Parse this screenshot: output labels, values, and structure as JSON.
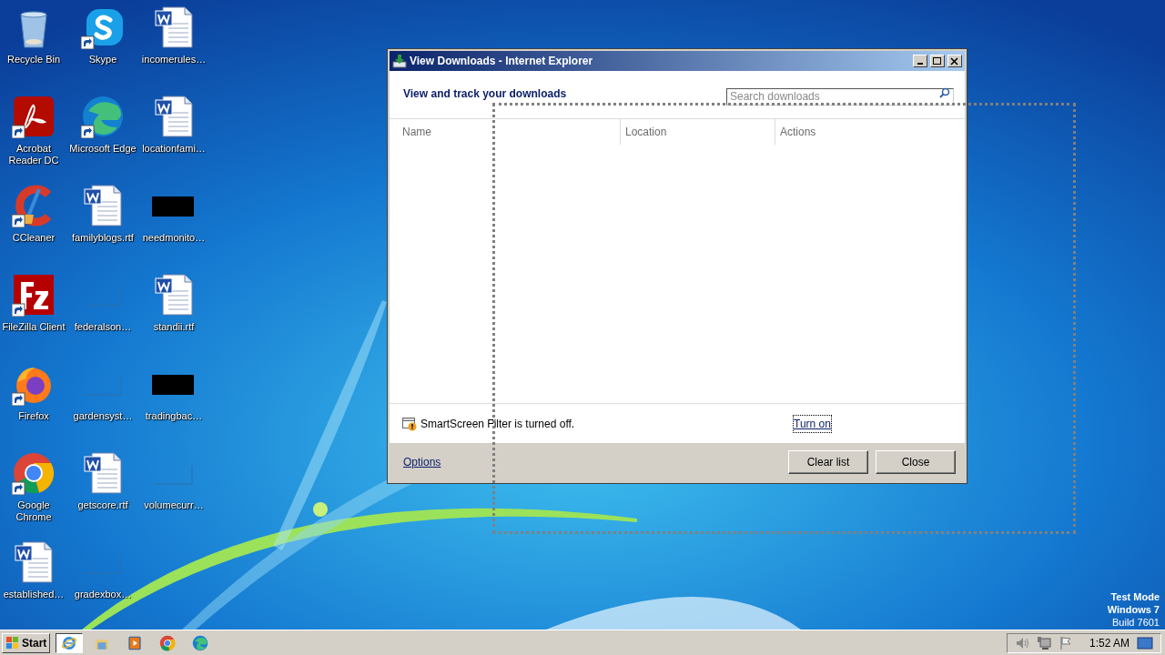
{
  "desktop": {
    "icons": [
      {
        "label": "Recycle Bin",
        "kind": "recycle",
        "shortcut": false
      },
      {
        "label": "Skype",
        "kind": "skype",
        "shortcut": true
      },
      {
        "label": "incomerules…",
        "kind": "word",
        "shortcut": false
      },
      {
        "label": "Acrobat Reader DC",
        "kind": "acrobat",
        "shortcut": true
      },
      {
        "label": "Microsoft Edge",
        "kind": "edge",
        "shortcut": true
      },
      {
        "label": "locationfami…",
        "kind": "word",
        "shortcut": false
      },
      {
        "label": "CCleaner",
        "kind": "ccleaner",
        "shortcut": true
      },
      {
        "label": "familyblogs.rtf",
        "kind": "word",
        "shortcut": false
      },
      {
        "label": "needmonito…",
        "kind": "dark",
        "shortcut": false
      },
      {
        "label": "FileZilla Client",
        "kind": "filezilla",
        "shortcut": true
      },
      {
        "label": "federalson…",
        "kind": "blank",
        "shortcut": false
      },
      {
        "label": "standii.rtf",
        "kind": "word",
        "shortcut": false
      },
      {
        "label": "Firefox",
        "kind": "firefox",
        "shortcut": true
      },
      {
        "label": "gardensyst…",
        "kind": "blank",
        "shortcut": false
      },
      {
        "label": "tradingbac…",
        "kind": "dark",
        "shortcut": false
      },
      {
        "label": "Google Chrome",
        "kind": "chrome",
        "shortcut": true
      },
      {
        "label": "getscore.rtf",
        "kind": "word",
        "shortcut": false
      },
      {
        "label": "volumecurr…",
        "kind": "blank",
        "shortcut": false
      },
      {
        "label": "established…",
        "kind": "word",
        "shortcut": false
      },
      {
        "label": "gradexbox…",
        "kind": "blank",
        "shortcut": false
      }
    ],
    "system_text": [
      "Test Mode",
      "Windows 7",
      "Build 7601"
    ]
  },
  "window": {
    "title": "View Downloads - Internet Explorer",
    "heading": "View and track your downloads",
    "search": {
      "placeholder": "Search downloads"
    },
    "columns": [
      "Name",
      "Location",
      "Actions"
    ],
    "smartscreen": {
      "message": "SmartScreen Filter is turned off.",
      "link": "Turn on",
      "focused": true
    },
    "options_link": "Options",
    "buttons": [
      "Clear list",
      "Close"
    ]
  },
  "taskbar": {
    "start": "Start",
    "apps": [
      {
        "kind": "ie",
        "selected": true
      },
      {
        "kind": "explorer",
        "selected": false
      },
      {
        "kind": "media",
        "selected": false
      },
      {
        "kind": "chrome",
        "selected": false
      },
      {
        "kind": "edge",
        "selected": false
      }
    ],
    "tray": {
      "clock": "1:52 AM"
    }
  }
}
